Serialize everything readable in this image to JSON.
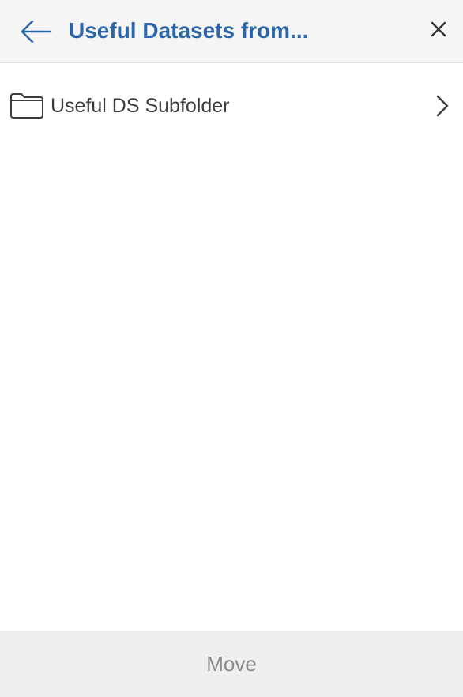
{
  "header": {
    "back_icon": "arrow-left-icon",
    "title": "Useful Datasets from...",
    "close_icon": "close-icon"
  },
  "folders": [
    {
      "label": "Useful DS Subfolder",
      "icon": "folder-icon",
      "chevron_icon": "chevron-right-icon"
    }
  ],
  "footer": {
    "move_label": "Move"
  },
  "colors": {
    "accent": "#2b65a8",
    "header_bg": "#f5f5f5",
    "footer_bg": "#eeeeee",
    "text": "#3c3c3c",
    "disabled_text": "#8c8c8c"
  }
}
